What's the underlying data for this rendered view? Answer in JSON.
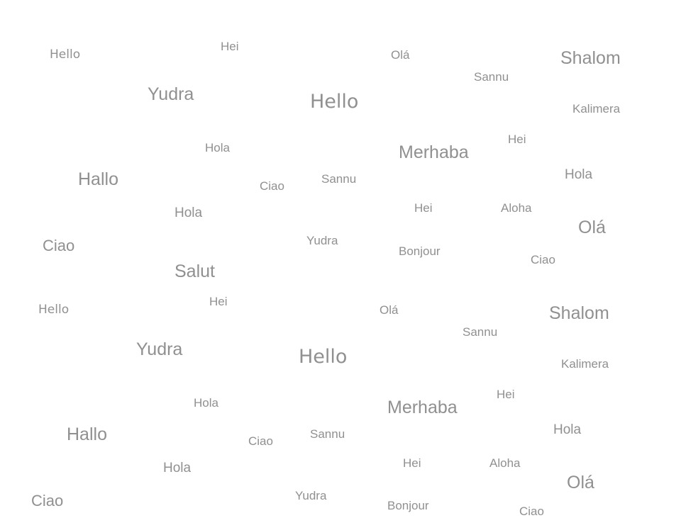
{
  "words": [
    "Hello",
    "Hei",
    "Olá",
    "Shalom",
    "Sannu",
    "Yudra",
    "Hello",
    "Kalimera",
    "Hei",
    "Hola",
    "Merhaba",
    "Hola",
    "Hallo",
    "Ciao",
    "Sannu",
    "Hola",
    "Hei",
    "Aloha",
    "Olá",
    "Ciao",
    "Yudra",
    "Bonjour",
    "Ciao",
    "Salut",
    "Hello",
    "Hei",
    "Olá",
    "Shalom",
    "Sannu",
    "Yudra",
    "Hello",
    "Kalimera",
    "Hei",
    "Hola",
    "Merhaba",
    "Hola",
    "Hallo",
    "Ciao",
    "Sannu",
    "Hola",
    "Hei",
    "Aloha",
    "Olá",
    "Ciao",
    "Yudra",
    "Bonjour",
    "Ciao"
  ]
}
